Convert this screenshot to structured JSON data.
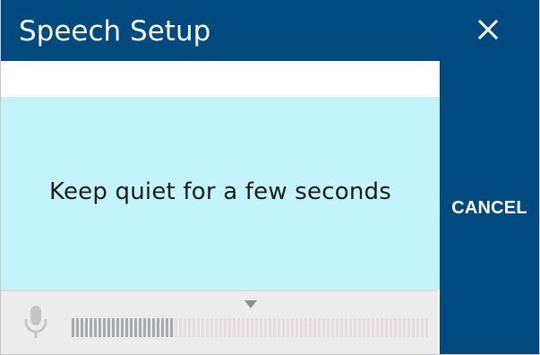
{
  "dialog": {
    "title": "Speech Setup",
    "close_icon": "close-icon",
    "message": "Keep quiet for a few seconds",
    "cancel_label": "CANCEL"
  },
  "meter": {
    "icon": "microphone-icon",
    "marker_icon": "triangle-down-icon",
    "level_fraction": 0.29,
    "threshold_fraction": 0.5,
    "active_color": "#a3a9ad",
    "inactive_color": "#e6dcdf"
  },
  "colors": {
    "header": "#004a7f",
    "message_background": "#c3f4fc",
    "meter_background": "#ececec"
  }
}
